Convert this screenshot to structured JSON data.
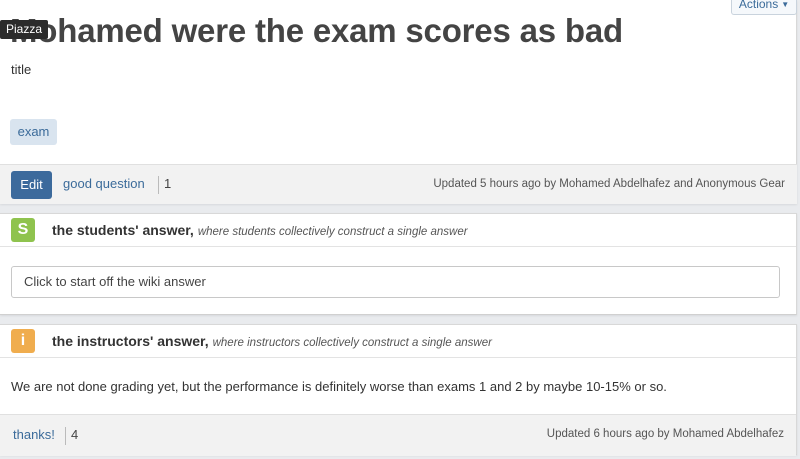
{
  "tooltip": "Piazza",
  "actions": {
    "label": "Actions"
  },
  "question": {
    "title": "Mohamed were the exam scores as bad",
    "body": "title",
    "tag": "exam",
    "edit_label": "Edit",
    "good_question_label": "good question",
    "good_question_count": "1",
    "updated": "Updated 5 hours ago by Mohamed Abdelhafez and Anonymous Gear"
  },
  "students_answer": {
    "badge": "S",
    "title": "the students' answer,",
    "subtitle": "where students collectively construct a single answer",
    "input_placeholder": "Click to start off the wiki answer",
    "badge_color": "#8fc34e"
  },
  "instructors_answer": {
    "badge": "i",
    "title": "the instructors' answer,",
    "subtitle": "where instructors collectively construct a single answer",
    "body": "We are not done grading yet, but the performance is definitely worse than exams 1 and 2 by maybe 10-15% or so.",
    "thanks_label": "thanks!",
    "thanks_count": "4",
    "updated": "Updated 6 hours ago by Mohamed Abdelhafez",
    "badge_color": "#f0ad4e"
  },
  "colors": {
    "link": "#3b6b9a",
    "edit_button": "#3c6a9c",
    "background": "#e9ebee"
  }
}
